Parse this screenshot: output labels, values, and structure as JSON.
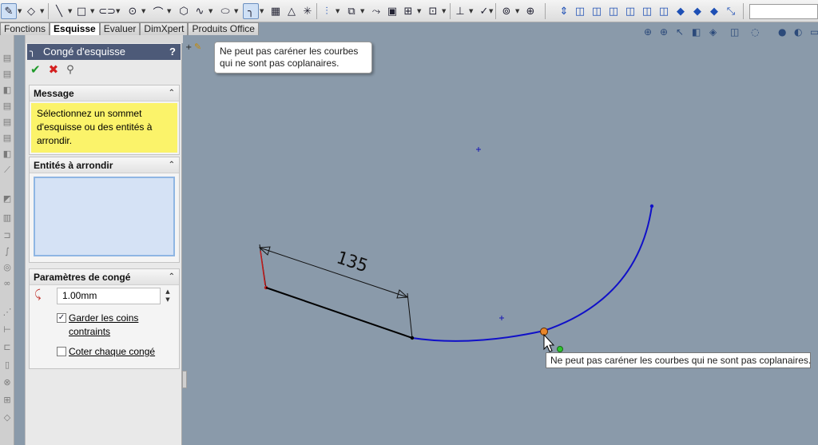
{
  "toolbar": {
    "icons": [
      "sketch-icon",
      "smart-dimension-icon",
      "line-icon",
      "rectangle-icon",
      "slot-icon",
      "circle-icon",
      "arc-icon",
      "polygon-icon",
      "spline-icon",
      "ellipse-icon",
      "sketch-fillet-icon",
      "grid-icon",
      "centerline-icon",
      "point-icon",
      "mirror-icon",
      "offset-icon",
      "trim-icon",
      "convert-icon",
      "linear-pattern-icon",
      "move-icon",
      "relations-icon",
      "repair-icon",
      "quick-snaps-icon",
      "view-orientation-icons"
    ]
  },
  "tabs": [
    "Fonctions",
    "Esquisse",
    "Evaluer",
    "DimXpert",
    "Produits Office"
  ],
  "active_tab": "Esquisse",
  "property_manager": {
    "title": "Congé d'esquisse",
    "help": "?",
    "message_header": "Message",
    "message_text": "Sélectionnez un sommet d'esquisse ou des entités à arrondir.",
    "entities_header": "Entités à arrondir",
    "params_header": "Paramètres de congé",
    "radius_value": "1.00mm",
    "keep_corners_label": "Garder les coins contraints",
    "keep_corners_checked": true,
    "dimension_each_label": "Coter chaque congé",
    "dimension_each_checked": false
  },
  "tooltip_top": "Ne peut pas caréner les courbes qui ne sont pas coplanaires.",
  "tooltip_cursor": "Ne peut pas caréner les courbes qui ne sont pas coplanaires.",
  "sketch": {
    "dimension_value": "135",
    "colors": {
      "background": "#8a9aaa",
      "line_selected": "#000000",
      "spline": "#1010c8",
      "endpoint_highlight": "#e8862a",
      "snap_point": "#2ec42e"
    }
  }
}
